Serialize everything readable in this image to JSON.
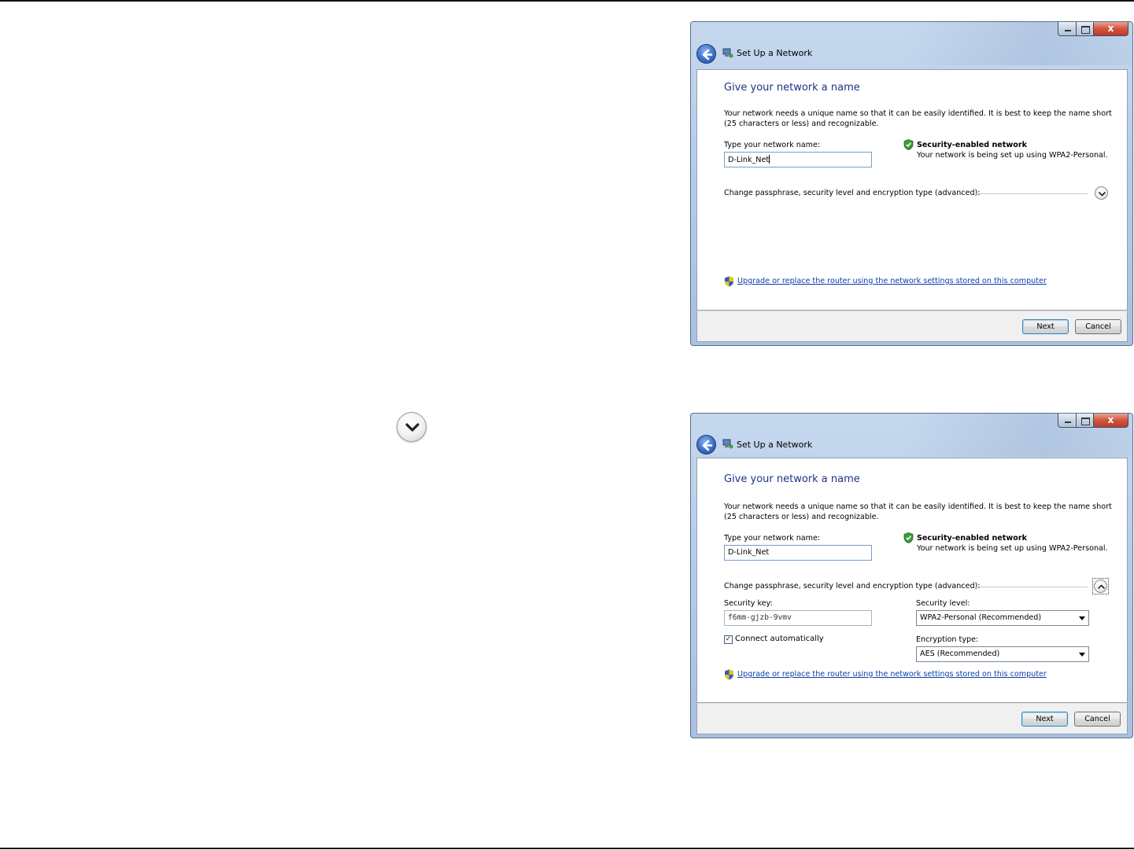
{
  "dialogs": [
    {
      "title": "Set Up a Network",
      "heading": "Give your network a name",
      "description": "Your network needs a unique name so that it can be easily identified. It is best to keep the name short (25 characters or less) and recognizable.",
      "network_name_label": "Type your network name:",
      "network_name_value": "D-Link_Net",
      "security_title": "Security-enabled network",
      "security_detail": "Your network is being set up using WPA2-Personal.",
      "advanced_label": "Change passphrase, security level and encryption type (advanced):",
      "upgrade_link": "Upgrade or replace the router using the network settings stored on this computer",
      "next_label": "Next",
      "cancel_label": "Cancel",
      "close_glyph": "x"
    },
    {
      "title": "Set Up a Network",
      "heading": "Give your network a name",
      "description": "Your network needs a unique name so that it can be easily identified. It is best to keep the name short (25 characters or less) and recognizable.",
      "network_name_label": "Type your network name:",
      "network_name_value": "D-Link_Net",
      "security_title": "Security-enabled network",
      "security_detail": "Your network is being set up using WPA2-Personal.",
      "advanced_label": "Change passphrase, security level and encryption type (advanced):",
      "security_key_label": "Security key:",
      "security_key_value": "f6mm-gjzb-9vmv",
      "security_level_label": "Security level:",
      "security_level_value": "WPA2-Personal (Recommended)",
      "connect_auto_label": "Connect automatically",
      "connect_auto_checked": true,
      "encryption_label": "Encryption type:",
      "encryption_value": "AES (Recommended)",
      "upgrade_link": "Upgrade or replace the router using the network settings stored on this computer",
      "next_label": "Next",
      "cancel_label": "Cancel",
      "close_glyph": "x"
    }
  ],
  "icons": {
    "expand_icon": "chevron-down-icon",
    "collapse_icon": "chevron-up-icon",
    "back_icon": "back-arrow-icon",
    "network_icon": "network-icon",
    "security_icon": "green-shield-check-icon",
    "uac_icon": "uac-shield-icon"
  },
  "colors": {
    "heading": "#1e3287",
    "link": "#0a3fa8",
    "frame": "#b8cde7"
  }
}
